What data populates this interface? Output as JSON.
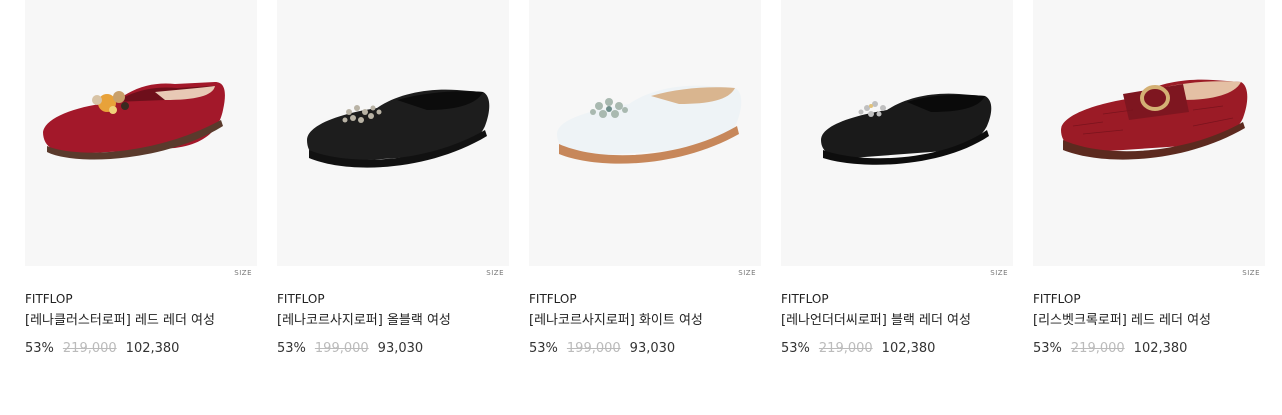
{
  "products": [
    {
      "brand": "FITFLOP",
      "name": "[레나클러스터로퍼] 레드 레더 여성",
      "discount": "53%",
      "original_price": "219,000",
      "sale_price": "102,380",
      "size_label": "SIZE",
      "shoe_color": "#a3182a",
      "ornament": "cluster-stones"
    },
    {
      "brand": "FITFLOP",
      "name": "[레나코르사지로퍼] 올블랙 여성",
      "discount": "53%",
      "original_price": "199,000",
      "sale_price": "93,030",
      "size_label": "SIZE",
      "shoe_color": "#1d1d1d",
      "ornament": "beaded-corsage"
    },
    {
      "brand": "FITFLOP",
      "name": "[레나코르사지로퍼] 화이트 여성",
      "discount": "53%",
      "original_price": "199,000",
      "sale_price": "93,030",
      "size_label": "SIZE",
      "shoe_color": "#eef3f6",
      "ornament": "crystal-corsage"
    },
    {
      "brand": "FITFLOP",
      "name": "[레나언더더씨로퍼] 블랙 레더 여성",
      "discount": "53%",
      "original_price": "219,000",
      "sale_price": "102,380",
      "size_label": "SIZE",
      "shoe_color": "#1a1a1a",
      "ornament": "jewel-brooch"
    },
    {
      "brand": "FITFLOP",
      "name": "[리스벳크록로퍼] 레드 레더 여성",
      "discount": "53%",
      "original_price": "219,000",
      "sale_price": "102,380",
      "size_label": "SIZE",
      "shoe_color": "#9b1b26",
      "ornament": "gold-buckle"
    }
  ]
}
